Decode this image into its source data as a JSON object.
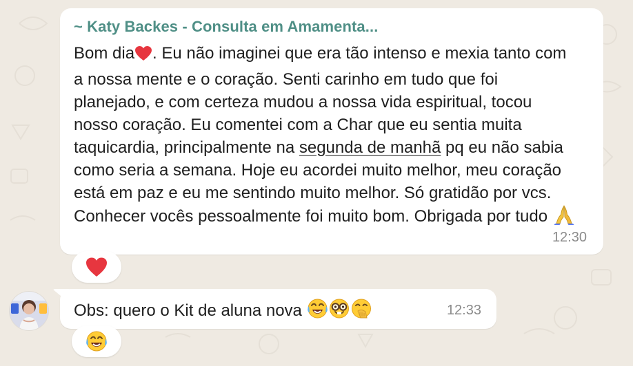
{
  "messages": [
    {
      "sender": "~ Katy Backes - Consulta em Amamenta...",
      "text_before_heart": "Bom dia",
      "text_after_heart": ". Eu não imaginei que era tão intenso e mexia tanto com a nossa mente e o coração. Senti carinho em tudo que foi planejado, e com certeza mudou a nossa vida espiritual, tocou nosso coração. Eu comentei com a Char que eu sentia muita taquicardia, principalmente na ",
      "link_text": "segunda de manhã",
      "text_after_link": " pq eu não sabia como seria a semana. Hoje eu acordei muito melhor, meu coração está em paz e eu me sentindo muito melhor. Só gratidão por vcs. Conhecer vocês pessoalmente foi muito bom. Obrigada por tudo ",
      "time": "12:30",
      "reaction_icon": "heart-icon",
      "inline_icons": [
        "heart-icon",
        "praying-hands-icon"
      ]
    },
    {
      "text": "Obs: quero o Kit de aluna nova ",
      "time": "12:33",
      "reaction_icon": "laughing-face-icon",
      "inline_icons": [
        "laughing-face-icon",
        "nerd-face-icon",
        "hand-over-mouth-face-icon"
      ]
    }
  ],
  "colors": {
    "background": "#efeae2",
    "bubble": "#ffffff",
    "sender": "#4f8f86",
    "text": "#1f1f1f",
    "time": "#8b8b8b"
  }
}
